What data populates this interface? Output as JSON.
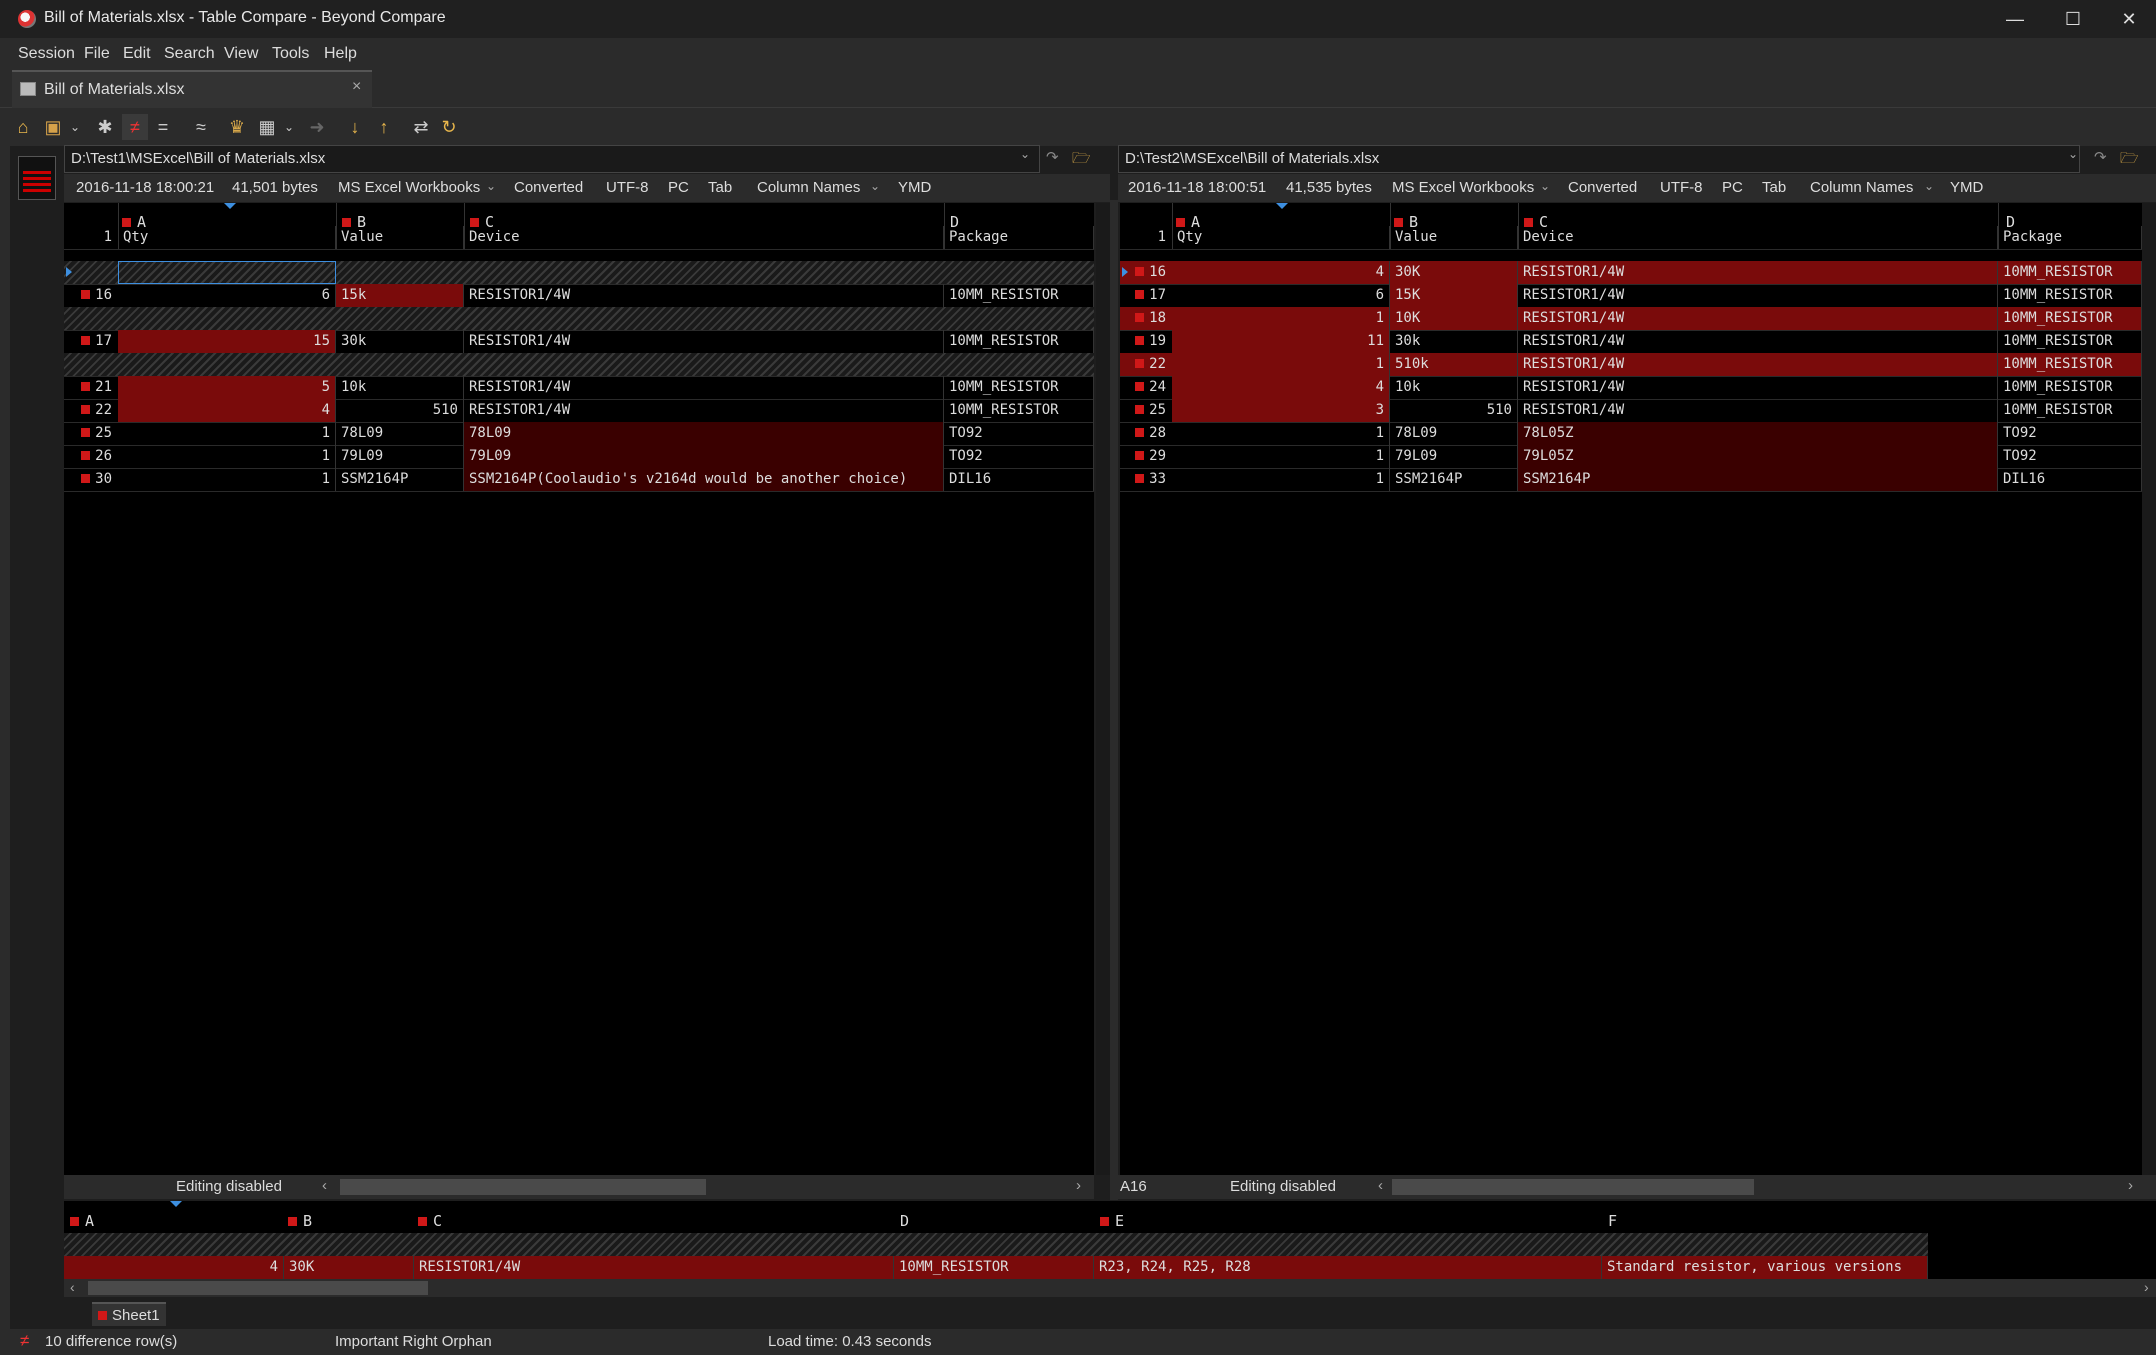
{
  "window": {
    "title": "Bill of Materials.xlsx - Table Compare - Beyond Compare"
  },
  "menu": [
    "Session",
    "File",
    "Edit",
    "Search",
    "View",
    "Tools",
    "Help"
  ],
  "tab": {
    "label": "Bill of Materials.xlsx"
  },
  "toolbar": {
    "icons": [
      "home-icon",
      "session-icon",
      "all-icon",
      "diffs-icon",
      "same-icon",
      "similar-icon",
      "rules-icon",
      "format-icon",
      "copy-icon",
      "next-diff-icon",
      "prev-diff-icon",
      "swap-icon",
      "refresh-icon"
    ]
  },
  "left": {
    "path": "D:\\Test1\\MSExcel\\Bill of Materials.xlsx",
    "info": {
      "timestamp": "2016-11-18 18:00:21",
      "size": "41,501 bytes",
      "format": "MS Excel Workbooks",
      "converted": "Converted",
      "encoding": "UTF-8",
      "lineend": "PC",
      "delim": "Tab",
      "header": "Column Names",
      "date": "YMD"
    },
    "columns": [
      "A",
      "B",
      "C",
      "D"
    ],
    "header_row": {
      "num": "1",
      "cells": [
        "Qty",
        "Value",
        "Device",
        "Package"
      ]
    },
    "rows": [
      {
        "num": "",
        "qty": "",
        "value": "",
        "device": "",
        "package": ""
      },
      {
        "num": "16",
        "qty": "6",
        "value": "15k",
        "device": "RESISTOR1/4W",
        "package": "10MM_RESISTOR"
      },
      {
        "num": "",
        "qty": "",
        "value": "",
        "device": "",
        "package": ""
      },
      {
        "num": "17",
        "qty": "15",
        "value": "30k",
        "device": "RESISTOR1/4W",
        "package": "10MM_RESISTOR"
      },
      {
        "num": "",
        "qty": "",
        "value": "",
        "device": "",
        "package": ""
      },
      {
        "num": "21",
        "qty": "5",
        "value": "10k",
        "device": "RESISTOR1/4W",
        "package": "10MM_RESISTOR"
      },
      {
        "num": "22",
        "qty": "4",
        "value": "510",
        "device": "RESISTOR1/4W",
        "package": "10MM_RESISTOR"
      },
      {
        "num": "25",
        "qty": "1",
        "value": "78L09",
        "device": "78L09",
        "package": "TO92"
      },
      {
        "num": "26",
        "qty": "1",
        "value": "79L09",
        "device": "79L09",
        "package": "TO92"
      },
      {
        "num": "30",
        "qty": "1",
        "value": "SSM2164P",
        "device": "SSM2164P(Coolaudio's v2164d would be another choice)",
        "package": "DIL16"
      }
    ],
    "status": "Editing disabled"
  },
  "right": {
    "path": "D:\\Test2\\MSExcel\\Bill of Materials.xlsx",
    "info": {
      "timestamp": "2016-11-18 18:00:51",
      "size": "41,535 bytes",
      "format": "MS Excel Workbooks",
      "converted": "Converted",
      "encoding": "UTF-8",
      "lineend": "PC",
      "delim": "Tab",
      "header": "Column Names",
      "date": "YMD"
    },
    "columns": [
      "A",
      "B",
      "C",
      "D"
    ],
    "header_row": {
      "num": "1",
      "cells": [
        "Qty",
        "Value",
        "Device",
        "Package"
      ]
    },
    "rows": [
      {
        "num": "16",
        "qty": "4",
        "value": "30K",
        "device": "RESISTOR1/4W",
        "package": "10MM_RESISTOR"
      },
      {
        "num": "17",
        "qty": "6",
        "value": "15K",
        "device": "RESISTOR1/4W",
        "package": "10MM_RESISTOR"
      },
      {
        "num": "18",
        "qty": "1",
        "value": "10K",
        "device": "RESISTOR1/4W",
        "package": "10MM_RESISTOR"
      },
      {
        "num": "19",
        "qty": "11",
        "value": "30k",
        "device": "RESISTOR1/4W",
        "package": "10MM_RESISTOR"
      },
      {
        "num": "22",
        "qty": "1",
        "value": "510k",
        "device": "RESISTOR1/4W",
        "package": "10MM_RESISTOR"
      },
      {
        "num": "24",
        "qty": "4",
        "value": "10k",
        "device": "RESISTOR1/4W",
        "package": "10MM_RESISTOR"
      },
      {
        "num": "25",
        "qty": "3",
        "value": "510",
        "device": "RESISTOR1/4W",
        "package": "10MM_RESISTOR"
      },
      {
        "num": "28",
        "qty": "1",
        "value": "78L09",
        "device": "78L05Z",
        "package": "TO92"
      },
      {
        "num": "29",
        "qty": "1",
        "value": "79L09",
        "device": "79L05Z",
        "package": "TO92"
      },
      {
        "num": "33",
        "qty": "1",
        "value": "SSM2164P",
        "device": "SSM2164P",
        "package": "DIL16"
      }
    ],
    "cellref": "A16",
    "status": "Editing disabled"
  },
  "detail": {
    "columns": [
      "A",
      "B",
      "C",
      "D",
      "E",
      "F"
    ],
    "row": [
      "4",
      "30K",
      "RESISTOR1/4W",
      "10MM_RESISTOR",
      "R23, R24, R25, R28",
      "Standard resistor, various versions"
    ]
  },
  "sheet_tab": "Sheet1",
  "statusbar": {
    "diffs": "10 difference row(s)",
    "orphan": "Important Right Orphan",
    "load": "Load time: 0.43 seconds"
  },
  "colors": {
    "diff": "#7a0b0b",
    "orphan": "#5a0000",
    "marker": "#d01818"
  }
}
